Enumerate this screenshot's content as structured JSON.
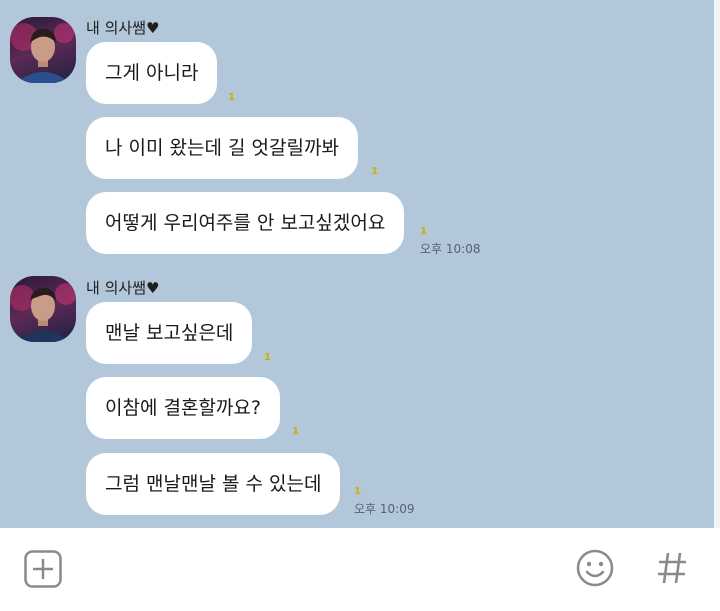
{
  "colors": {
    "chat_bg": "#b2c7d9",
    "bubble": "#ffffff",
    "unread": "#c9b100"
  },
  "groups": [
    {
      "sender": "내 의사쌤♥",
      "messages": [
        {
          "text": "그게 아니라",
          "unread": "1"
        },
        {
          "text": "나 이미 왔는데 길 엇갈릴까봐",
          "unread": "1"
        },
        {
          "text": "어떻게 우리여주를 안 보고싶겠어요",
          "unread": "1",
          "time": "오후 10:08"
        }
      ]
    },
    {
      "sender": "내 의사쌤♥",
      "messages": [
        {
          "text": "맨날 보고싶은데",
          "unread": "1"
        },
        {
          "text": "이참에 결혼할까요?",
          "unread": "1"
        },
        {
          "text": "그럼 맨날맨날 볼 수 있는데",
          "unread": "1",
          "time": "오후 10:09"
        }
      ]
    }
  ],
  "input_bar": {
    "icons": [
      "plus-icon",
      "emoticon-icon",
      "hash-icon"
    ]
  }
}
